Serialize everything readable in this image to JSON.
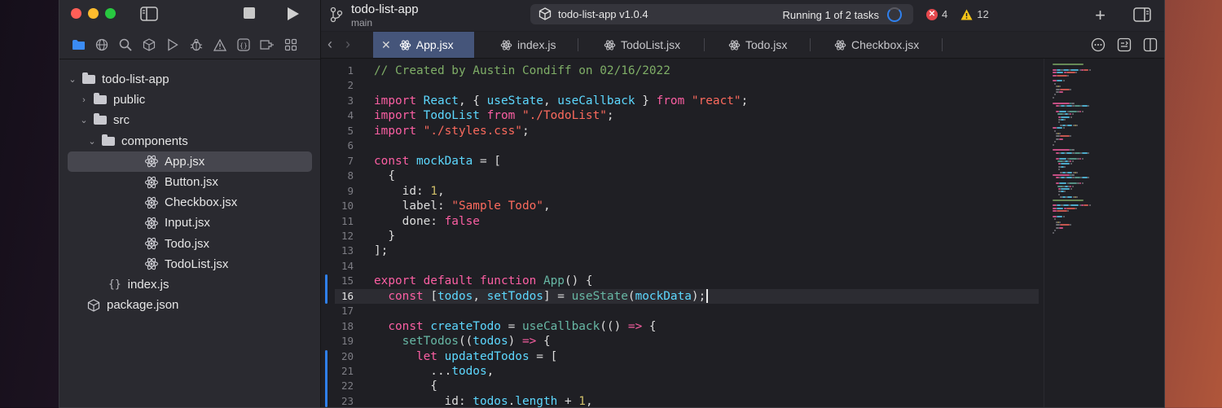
{
  "sidebar": {
    "tree": [
      {
        "label": "todo-list-app",
        "type": "folder",
        "depth": 0,
        "expanded": true
      },
      {
        "label": "public",
        "type": "folder",
        "depth": 1,
        "expanded": false
      },
      {
        "label": "src",
        "type": "folder",
        "depth": 1,
        "expanded": true
      },
      {
        "label": "components",
        "type": "folder",
        "depth": 2,
        "expanded": true
      },
      {
        "label": "App.jsx",
        "type": "react",
        "depth": 3,
        "selected": true
      },
      {
        "label": "Button.jsx",
        "type": "react",
        "depth": 3
      },
      {
        "label": "Checkbox.jsx",
        "type": "react",
        "depth": 3
      },
      {
        "label": "Input.jsx",
        "type": "react",
        "depth": 3
      },
      {
        "label": "Todo.jsx",
        "type": "react",
        "depth": 3
      },
      {
        "label": "TodoList.jsx",
        "type": "react",
        "depth": 3
      },
      {
        "label": "index.js",
        "type": "js",
        "depth": 2
      },
      {
        "label": "package.json",
        "type": "package",
        "depth": 1
      }
    ],
    "nav_icons": [
      "folder-icon",
      "globe-icon",
      "search-icon",
      "cube-icon",
      "play-outline-icon",
      "bug-icon",
      "warning-icon",
      "braces-icon",
      "tag-icon",
      "grid-icon"
    ]
  },
  "toolbar": {
    "project": "todo-list-app",
    "branch": "main",
    "scheme": "todo-list-app v1.0.4",
    "status": "Running 1 of 2 tasks",
    "errors": "4",
    "warnings": "12"
  },
  "tabs": [
    {
      "label": "App.jsx",
      "active": true
    },
    {
      "label": "index.js"
    },
    {
      "label": "TodoList.jsx"
    },
    {
      "label": "Todo.jsx"
    },
    {
      "label": "Checkbox.jsx"
    }
  ],
  "editor": {
    "current_line": 16,
    "lines": [
      [
        [
          "c-com",
          "// Created by Austin Condiff on 02/16/2022"
        ]
      ],
      [],
      [
        [
          "c-kw",
          "import "
        ],
        [
          "c-id",
          "React"
        ],
        [
          "c-def",
          ", { "
        ],
        [
          "c-id",
          "useState"
        ],
        [
          "c-def",
          ", "
        ],
        [
          "c-id",
          "useCallback"
        ],
        [
          "c-def",
          " } "
        ],
        [
          "c-kw",
          "from "
        ],
        [
          "c-str",
          "\"react\""
        ],
        [
          "c-def",
          ";"
        ]
      ],
      [
        [
          "c-kw",
          "import "
        ],
        [
          "c-id",
          "TodoList"
        ],
        [
          "c-kw",
          " from "
        ],
        [
          "c-str",
          "\"./TodoList\""
        ],
        [
          "c-def",
          ";"
        ]
      ],
      [
        [
          "c-kw",
          "import "
        ],
        [
          "c-str",
          "\"./styles.css\""
        ],
        [
          "c-def",
          ";"
        ]
      ],
      [],
      [
        [
          "c-kw",
          "const "
        ],
        [
          "c-id",
          "mockData"
        ],
        [
          "c-def",
          " = ["
        ]
      ],
      [
        [
          "c-def",
          "  {"
        ]
      ],
      [
        [
          "c-def",
          "    id: "
        ],
        [
          "c-num",
          "1"
        ],
        [
          "c-def",
          ","
        ]
      ],
      [
        [
          "c-def",
          "    label: "
        ],
        [
          "c-str",
          "\"Sample Todo\""
        ],
        [
          "c-def",
          ","
        ]
      ],
      [
        [
          "c-def",
          "    done: "
        ],
        [
          "c-bool",
          "false"
        ]
      ],
      [
        [
          "c-def",
          "  }"
        ]
      ],
      [
        [
          "c-def",
          "];"
        ]
      ],
      [],
      [
        [
          "c-kw",
          "export default function "
        ],
        [
          "c-fn",
          "App"
        ],
        [
          "c-def",
          "() {"
        ]
      ],
      [
        [
          "c-def",
          "  "
        ],
        [
          "c-kw",
          "const "
        ],
        [
          "c-def",
          "["
        ],
        [
          "c-id",
          "todos"
        ],
        [
          "c-def",
          ", "
        ],
        [
          "c-id",
          "setTodos"
        ],
        [
          "c-def",
          "] = "
        ],
        [
          "c-fn",
          "useState"
        ],
        [
          "c-def",
          "("
        ],
        [
          "c-id",
          "mockData"
        ],
        [
          "c-def",
          ");"
        ]
      ],
      [],
      [
        [
          "c-def",
          "  "
        ],
        [
          "c-kw",
          "const "
        ],
        [
          "c-id",
          "createTodo"
        ],
        [
          "c-def",
          " = "
        ],
        [
          "c-fn",
          "useCallback"
        ],
        [
          "c-def",
          "(() "
        ],
        [
          "c-kw",
          "=>"
        ],
        [
          "c-def",
          " {"
        ]
      ],
      [
        [
          "c-def",
          "    "
        ],
        [
          "c-fn",
          "setTodos"
        ],
        [
          "c-def",
          "(("
        ],
        [
          "c-id",
          "todos"
        ],
        [
          "c-def",
          ") "
        ],
        [
          "c-kw",
          "=>"
        ],
        [
          "c-def",
          " {"
        ]
      ],
      [
        [
          "c-def",
          "      "
        ],
        [
          "c-kw",
          "let "
        ],
        [
          "c-id",
          "updatedTodos"
        ],
        [
          "c-def",
          " = ["
        ]
      ],
      [
        [
          "c-def",
          "        ..."
        ],
        [
          "c-id",
          "todos"
        ],
        [
          "c-def",
          ","
        ]
      ],
      [
        [
          "c-def",
          "        {"
        ]
      ],
      [
        [
          "c-def",
          "          id: "
        ],
        [
          "c-id",
          "todos"
        ],
        [
          "c-def",
          "."
        ],
        [
          "c-id",
          "length"
        ],
        [
          "c-def",
          " + "
        ],
        [
          "c-num",
          "1"
        ],
        [
          "c-def",
          ","
        ]
      ]
    ]
  }
}
